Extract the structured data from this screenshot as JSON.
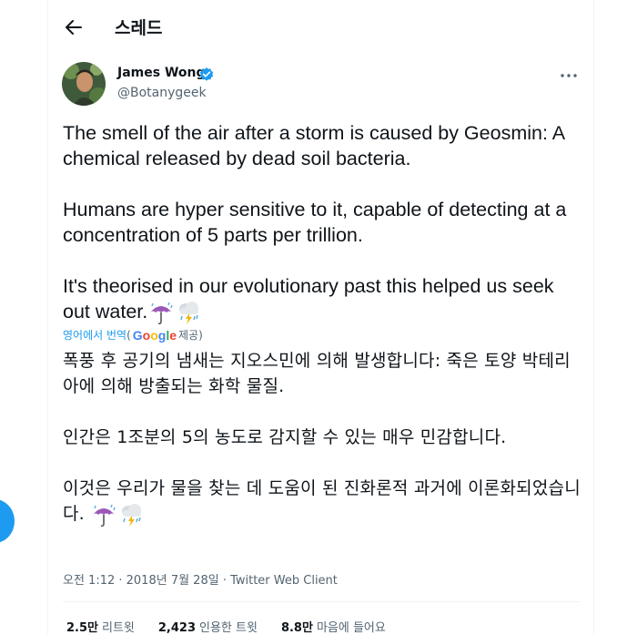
{
  "header": {
    "back_icon": "arrow-left-icon",
    "title": "스레드"
  },
  "author": {
    "name": "James Wong",
    "handle": "@Botanygeek",
    "verified": true,
    "verified_color": "#1d9bf0"
  },
  "tweet": {
    "paragraphs": [
      "The smell of the air after a storm is caused by Geosmin: A chemical released by dead soil bacteria.",
      "Humans are hyper sensitive to it, capable of detecting at a concentration of 5 parts per trillion.",
      "It's theorised in our evolutionary past this helped us seek out water."
    ]
  },
  "translation": {
    "link_text": "영어에서 번역",
    "open_paren": "(",
    "provider": "Google",
    "provider_suffix": "제공)",
    "paragraphs": [
      "폭풍 후 공기의 냄새는 지오스민에 의해 발생합니다: 죽은 토양 박테리아에 의해 방출되는 화학 물질.",
      " 인간은 1조분의 5의 농도로 감지할 수 있는 매우 민감합니다.",
      " 이것은 우리가 물을 찾는 데 도움이 된 진화론적 과거에 이론화되었습니다."
    ]
  },
  "meta": {
    "timestamp": "오전 1:12 · 2018년 7월 28일 · Twitter Web Client"
  },
  "stats": [
    {
      "value": "2.5만",
      "label": "리트윗"
    },
    {
      "value": "2,423",
      "label": "인용한 트윗"
    },
    {
      "value": "8.8만",
      "label": "마음에 들어요"
    }
  ],
  "colors": {
    "accent": "#1d9bf0",
    "secondary_text": "#536471",
    "primary_text": "#0f1419"
  }
}
